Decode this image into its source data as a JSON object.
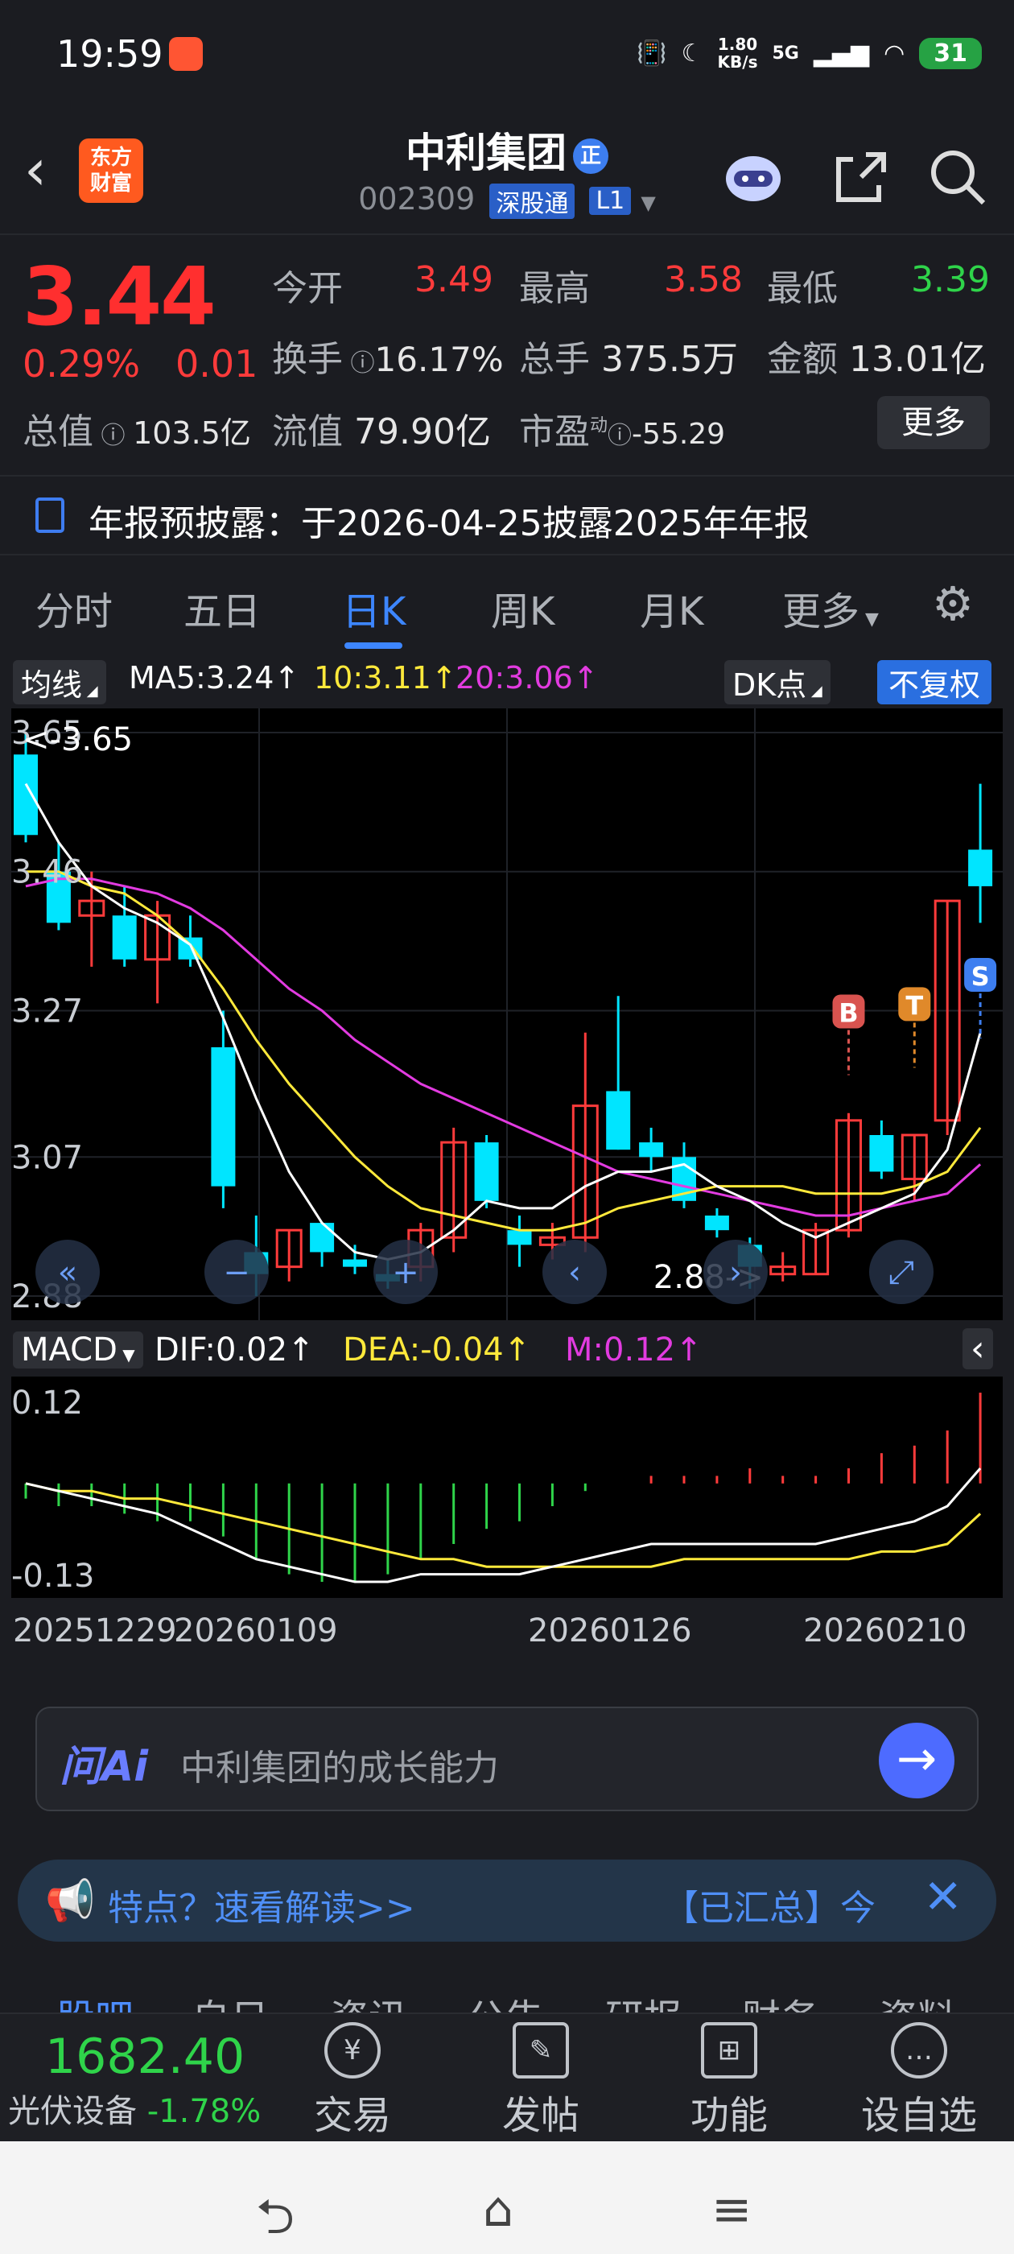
{
  "status": {
    "time": "19:59",
    "speed": "1.80",
    "speed_unit": "KB/s",
    "network": "5G",
    "battery": "31"
  },
  "header": {
    "logo_line1": "东方",
    "logo_line2": "财富",
    "title": "中利集团",
    "badge": "正",
    "code": "002309",
    "market_tag": "深股通",
    "level_tag": "L1"
  },
  "quote": {
    "price": "3.44",
    "change_pct": "0.29%",
    "change_abs": "0.01",
    "open_label": "今开",
    "open": "3.49",
    "high_label": "最高",
    "high": "3.58",
    "low_label": "最低",
    "low": "3.39",
    "turnover_label": "换手",
    "turnover": "16.17%",
    "volume_label": "总手",
    "volume": "375.5万",
    "amount_label": "金额",
    "amount": "13.01亿",
    "mktcap_label": "总值",
    "mktcap": "103.5亿",
    "float_label": "流值",
    "float": "79.90亿",
    "pe_label": "市盈",
    "pe_sup": "动",
    "pe": "-55.29",
    "more_label": "更多"
  },
  "notice": {
    "text": "年报预披露：于2026-04-25披露2025年年报"
  },
  "tabs": [
    "分时",
    "五日",
    "日K",
    "周K",
    "月K",
    "更多"
  ],
  "active_tab": "日K",
  "ma_bar": {
    "type": "均线",
    "ma5": "MA5:3.24",
    "ma10": "10:3.11",
    "ma20": "20:3.06",
    "dk": "DK点",
    "fq": "不复权"
  },
  "kline": {
    "y_ticks": [
      "3.65",
      "3.46",
      "3.27",
      "3.07",
      "2.88"
    ],
    "max_label": "<-3.65",
    "min_label": "2.88->",
    "signal_B": "B",
    "signal_T": "T",
    "signal_S": "S"
  },
  "chart_data": {
    "type": "candlestick",
    "dates_visible": [
      "20251229",
      "20260109",
      "20260126",
      "20260210"
    ],
    "ylim": [
      2.88,
      3.65
    ],
    "candles": [
      {
        "o": 3.62,
        "h": 3.65,
        "l": 3.5,
        "c": 3.51
      },
      {
        "o": 3.46,
        "h": 3.5,
        "l": 3.38,
        "c": 3.39
      },
      {
        "o": 3.4,
        "h": 3.46,
        "l": 3.33,
        "c": 3.42
      },
      {
        "o": 3.4,
        "h": 3.44,
        "l": 3.33,
        "c": 3.34
      },
      {
        "o": 3.34,
        "h": 3.42,
        "l": 3.28,
        "c": 3.4
      },
      {
        "o": 3.37,
        "h": 3.4,
        "l": 3.33,
        "c": 3.34
      },
      {
        "o": 3.22,
        "h": 3.27,
        "l": 3.0,
        "c": 3.03
      },
      {
        "o": 2.94,
        "h": 2.99,
        "l": 2.88,
        "c": 2.91
      },
      {
        "o": 2.92,
        "h": 2.97,
        "l": 2.9,
        "c": 2.97
      },
      {
        "o": 2.98,
        "h": 2.98,
        "l": 2.92,
        "c": 2.94
      },
      {
        "o": 2.93,
        "h": 2.95,
        "l": 2.91,
        "c": 2.92
      },
      {
        "o": 2.91,
        "h": 2.93,
        "l": 2.89,
        "c": 2.9
      },
      {
        "o": 2.92,
        "h": 2.98,
        "l": 2.9,
        "c": 2.97
      },
      {
        "o": 2.96,
        "h": 3.11,
        "l": 2.94,
        "c": 3.09
      },
      {
        "o": 3.09,
        "h": 3.1,
        "l": 3.0,
        "c": 3.01
      },
      {
        "o": 2.97,
        "h": 2.99,
        "l": 2.92,
        "c": 2.95
      },
      {
        "o": 2.95,
        "h": 2.98,
        "l": 2.93,
        "c": 2.96
      },
      {
        "o": 2.96,
        "h": 3.24,
        "l": 2.94,
        "c": 3.14
      },
      {
        "o": 3.16,
        "h": 3.29,
        "l": 3.08,
        "c": 3.08
      },
      {
        "o": 3.09,
        "h": 3.11,
        "l": 3.05,
        "c": 3.07
      },
      {
        "o": 3.07,
        "h": 3.09,
        "l": 3.0,
        "c": 3.01
      },
      {
        "o": 2.99,
        "h": 3.0,
        "l": 2.96,
        "c": 2.97
      },
      {
        "o": 2.95,
        "h": 2.96,
        "l": 2.89,
        "c": 2.92
      },
      {
        "o": 2.91,
        "h": 2.94,
        "l": 2.9,
        "c": 2.92
      },
      {
        "o": 2.91,
        "h": 2.98,
        "l": 2.91,
        "c": 2.97
      },
      {
        "o": 2.97,
        "h": 3.13,
        "l": 2.96,
        "c": 3.12
      },
      {
        "o": 3.1,
        "h": 3.12,
        "l": 3.04,
        "c": 3.05
      },
      {
        "o": 3.04,
        "h": 3.1,
        "l": 3.01,
        "c": 3.1
      },
      {
        "o": 3.12,
        "h": 3.42,
        "l": 3.1,
        "c": 3.42
      },
      {
        "o": 3.49,
        "h": 3.58,
        "l": 3.39,
        "c": 3.44
      }
    ],
    "ma5": [
      3.58,
      3.5,
      3.44,
      3.41,
      3.39,
      3.36,
      3.26,
      3.15,
      3.05,
      2.98,
      2.94,
      2.93,
      2.94,
      2.97,
      3.01,
      3.0,
      3.0,
      3.03,
      3.05,
      3.05,
      3.06,
      3.03,
      3.01,
      2.98,
      2.96,
      2.98,
      3.0,
      3.02,
      3.08,
      3.24
    ],
    "ma10": [
      3.46,
      3.46,
      3.44,
      3.43,
      3.4,
      3.36,
      3.3,
      3.23,
      3.17,
      3.12,
      3.07,
      3.03,
      3.0,
      2.99,
      2.98,
      2.97,
      2.97,
      2.98,
      3.0,
      3.01,
      3.02,
      3.03,
      3.03,
      3.03,
      3.02,
      3.02,
      3.02,
      3.03,
      3.05,
      3.11
    ],
    "ma20": [
      3.44,
      3.45,
      3.45,
      3.44,
      3.43,
      3.41,
      3.38,
      3.34,
      3.3,
      3.27,
      3.23,
      3.2,
      3.17,
      3.15,
      3.13,
      3.11,
      3.09,
      3.07,
      3.05,
      3.04,
      3.03,
      3.02,
      3.01,
      3.0,
      2.99,
      2.99,
      3.0,
      3.01,
      3.02,
      3.06
    ],
    "macd": {
      "dif": "DIF:0.02",
      "dea": "DEA:-0.04",
      "m": "M:0.12",
      "ylim": [
        -0.13,
        0.12
      ],
      "y_ticks": [
        "0.12",
        "-0.13"
      ],
      "hist": [
        -0.02,
        -0.03,
        -0.03,
        -0.04,
        -0.05,
        -0.05,
        -0.07,
        -0.1,
        -0.12,
        -0.13,
        -0.13,
        -0.12,
        -0.1,
        -0.08,
        -0.06,
        -0.05,
        -0.03,
        -0.01,
        0.0,
        0.01,
        0.01,
        0.01,
        0.02,
        0.01,
        0.01,
        0.02,
        0.04,
        0.05,
        0.07,
        0.12
      ],
      "dif_line": [
        0.0,
        -0.01,
        -0.02,
        -0.03,
        -0.04,
        -0.06,
        -0.08,
        -0.1,
        -0.11,
        -0.12,
        -0.13,
        -0.13,
        -0.12,
        -0.12,
        -0.12,
        -0.12,
        -0.11,
        -0.1,
        -0.09,
        -0.08,
        -0.08,
        -0.08,
        -0.08,
        -0.08,
        -0.08,
        -0.07,
        -0.06,
        -0.05,
        -0.03,
        0.02
      ],
      "dea_line": [
        0.0,
        -0.01,
        -0.01,
        -0.02,
        -0.02,
        -0.03,
        -0.04,
        -0.05,
        -0.06,
        -0.07,
        -0.08,
        -0.09,
        -0.1,
        -0.1,
        -0.11,
        -0.11,
        -0.11,
        -0.11,
        -0.11,
        -0.11,
        -0.1,
        -0.1,
        -0.1,
        -0.1,
        -0.1,
        -0.1,
        -0.09,
        -0.09,
        -0.08,
        -0.04
      ]
    }
  },
  "macd_bar": {
    "type": "MACD"
  },
  "ai": {
    "brand": "问Ai",
    "prompt": "中利集团的成长能力",
    "go": "→"
  },
  "feature": {
    "text": "特点？速看解读>>",
    "right": "【已汇总】今",
    "close": "✕"
  },
  "subtabs": [
    "股吧",
    "自日",
    "资讯",
    "公告",
    "研报",
    "财务",
    "资料"
  ],
  "bottom": {
    "index_value": "1682.40",
    "index_name": "光伏设备",
    "index_chg": "-1.78%",
    "items": [
      {
        "icon": "¥",
        "label": "交易"
      },
      {
        "icon": "✎",
        "label": "发帖"
      },
      {
        "icon": "⊞",
        "label": "功能"
      },
      {
        "icon": "…",
        "label": "设自选"
      }
    ]
  },
  "nav": {
    "back": "⮌",
    "home": "⌂",
    "menu": "≡"
  },
  "colors": {
    "up": "#ff3b3b",
    "down": "#00e5ff",
    "ma5": "#ffffff",
    "ma10": "#ffe93b",
    "ma20": "#e23be0",
    "accent": "#3d86ff"
  }
}
